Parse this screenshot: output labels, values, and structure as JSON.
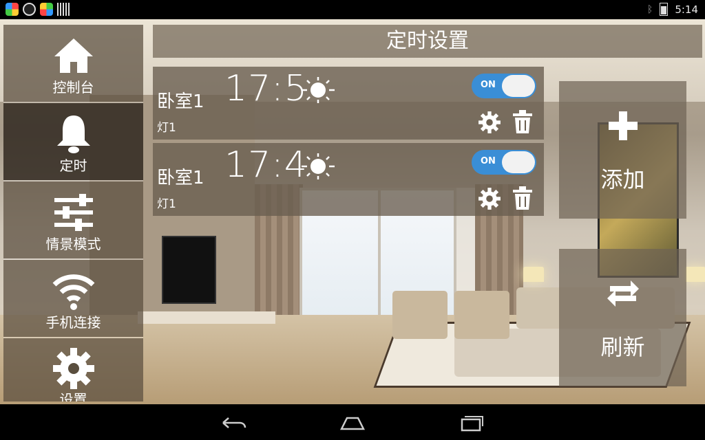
{
  "status_bar": {
    "clock": "5:14",
    "icons": [
      "app-icon",
      "app-icon",
      "app-icon",
      "barcode-icon",
      "bluetooth-icon",
      "battery-icon"
    ]
  },
  "sidebar": {
    "items": [
      {
        "label": "控制台",
        "icon": "home-icon",
        "active": false
      },
      {
        "label": "定时",
        "icon": "bell-icon",
        "active": true
      },
      {
        "label": "情景模式",
        "icon": "sliders-icon",
        "active": false
      },
      {
        "label": "手机连接",
        "icon": "wifi-icon",
        "active": false
      },
      {
        "label": "设置",
        "icon": "gear-icon",
        "active": false
      }
    ]
  },
  "header": {
    "title": "定时设置"
  },
  "timers": [
    {
      "room": "卧室1",
      "device": "灯1",
      "time": "17:5",
      "icon": "sun-icon",
      "toggle_label": "ON",
      "enabled": true
    },
    {
      "room": "卧室1",
      "device": "灯1",
      "time": "17:4",
      "icon": "sun-icon",
      "toggle_label": "ON",
      "enabled": true
    }
  ],
  "actions": {
    "add_label": "添加",
    "refresh_label": "刷新"
  },
  "colors": {
    "toggle_on": "#3a8ed6",
    "panel_text": "#ffffff"
  },
  "nav_bar": {
    "icons": [
      "back-icon",
      "home-nav-icon",
      "recents-icon"
    ]
  }
}
